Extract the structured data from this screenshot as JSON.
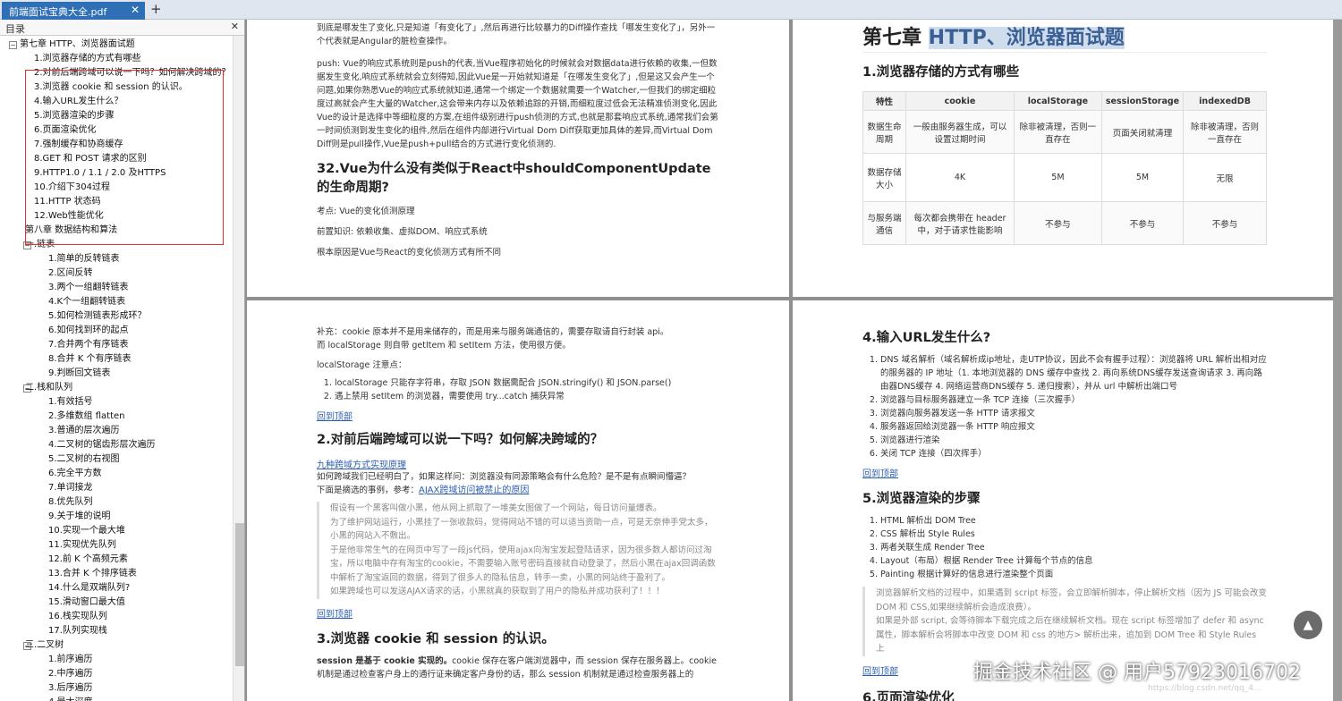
{
  "tab": {
    "title": "前端面试宝典大全.pdf",
    "close": "✕",
    "new": "+"
  },
  "toc": {
    "header": "目录",
    "close": "✕",
    "items": [
      {
        "label": "第七章 HTTP、浏览器面试题",
        "level": 0,
        "toggle": "⊟"
      },
      {
        "label": "1.浏览器存储的方式有哪些",
        "level": 2
      },
      {
        "label": "2.对前后端跨域可以说一下吗？如何解决跨域的？",
        "level": 2
      },
      {
        "label": "3.浏览器 cookie 和 session 的认识。",
        "level": 2
      },
      {
        "label": "4.输入URL发生什么？",
        "level": 2
      },
      {
        "label": "5.浏览器渲染的步骤",
        "level": 2
      },
      {
        "label": "6.页面渲染优化",
        "level": 2
      },
      {
        "label": "7.强制缓存和协商缓存",
        "level": 2
      },
      {
        "label": "8.GET 和 POST 请求的区别",
        "level": 2
      },
      {
        "label": "9.HTTP1.0 / 1.1 / 2.0 及HTTPS",
        "level": 2
      },
      {
        "label": "10.介绍下304过程",
        "level": 2
      },
      {
        "label": "11.HTTP 状态码",
        "level": 2
      },
      {
        "label": "12.Web性能优化",
        "level": 2
      },
      {
        "label": "第八章 数据结构和算法",
        "level": 1
      },
      {
        "label": "一.链表",
        "level": 1,
        "toggle": "⊟"
      },
      {
        "label": "1.简单的反转链表",
        "level": 3
      },
      {
        "label": "2.区间反转",
        "level": 3
      },
      {
        "label": "3.两个一组翻转链表",
        "level": 3
      },
      {
        "label": "4.K个一组翻转链表",
        "level": 3
      },
      {
        "label": "5.如何检测链表形成环？",
        "level": 3
      },
      {
        "label": "6.如何找到环的起点",
        "level": 3
      },
      {
        "label": "7.合并两个有序链表",
        "level": 3
      },
      {
        "label": "8.合并 K 个有序链表",
        "level": 3
      },
      {
        "label": "9.判断回文链表",
        "level": 3
      },
      {
        "label": "二.栈和队列",
        "level": 1,
        "toggle": "⊟"
      },
      {
        "label": "1.有效括号",
        "level": 3
      },
      {
        "label": "2.多维数组 flatten",
        "level": 3
      },
      {
        "label": "3.普通的层次遍历",
        "level": 3
      },
      {
        "label": "4.二叉树的锯齿形层次遍历",
        "level": 3
      },
      {
        "label": "5.二叉树的右视图",
        "level": 3
      },
      {
        "label": "6.完全平方数",
        "level": 3
      },
      {
        "label": "7.单词接龙",
        "level": 3
      },
      {
        "label": "8.优先队列",
        "level": 3
      },
      {
        "label": "9.关于堆的说明",
        "level": 3
      },
      {
        "label": "10.实现一个最大堆",
        "level": 3
      },
      {
        "label": "11.实现优先队列",
        "level": 3
      },
      {
        "label": "12.前 K 个高频元素",
        "level": 3
      },
      {
        "label": "13.合并 K 个排序链表",
        "level": 3
      },
      {
        "label": "14.什么是双端队列?",
        "level": 3
      },
      {
        "label": "15.滑动窗口最大值",
        "level": 3
      },
      {
        "label": "16.栈实现队列",
        "level": 3
      },
      {
        "label": "17.队列实现栈",
        "level": 3
      },
      {
        "label": "三.二叉树",
        "level": 1,
        "toggle": "⊟"
      },
      {
        "label": "1.前序遍历",
        "level": 3
      },
      {
        "label": "2.中序遍历",
        "level": 3
      },
      {
        "label": "3.后序遍历",
        "level": 3
      },
      {
        "label": "4.最大深度",
        "level": 3
      }
    ]
  },
  "tl": {
    "p1": "到底是哪发生了变化,只是知道「有变化了」,然后再进行比较暴力的Diff操作查找「哪发生变化了」，另外一个代表就是Angular的脏检查操作。",
    "p2": "push: Vue的响应式系统则是push的代表,当Vue程序初始化的时候就会对数据data进行依赖的收集,一但数据发生变化,响应式系统就会立刻得知,因此Vue是一开始就知道是「在哪发生变化了」,但是这又会产生一个问题,如果你熟悉Vue的响应式系统就知道,通常一个绑定一个数据就需要一个Watcher,一但我们的绑定细粒度过高就会产生大量的Watcher,这会带来内存以及依赖追踪的开销,而细粒度过低会无法精准侦测变化,因此Vue的设计是选择中等细粒度的方案,在组件级别进行push侦测的方式,也就是那套响应式系统,通常我们会第一时间侦测到发生变化的组件,然后在组件内部进行Virtual Dom Diff获取更加具体的差异,而Virtual Dom Diff则是pull操作,Vue是push+pull结合的方式进行变化侦测的.",
    "h32": "32.Vue为什么没有类似于React中shouldComponentUpdate的生命周期?",
    "p3": "考点: Vue的变化侦测原理",
    "p4": "前置知识: 依赖收集、虚拟DOM、响应式系统",
    "p5": "根本原因是Vue与React的变化侦测方式有所不同"
  },
  "tr": {
    "chapter": "第七章 ",
    "chapter_hl": "HTTP、浏览器面试题",
    "h1": "1.浏览器存储的方式有哪些",
    "headers": [
      "特性",
      "cookie",
      "localStorage",
      "sessionStorage",
      "indexedDB"
    ],
    "rows": [
      [
        "数据生命周期",
        "一般由服务器生成，可以设置过期时间",
        "除非被清理，否则一直存在",
        "页面关闭就清理",
        "除非被清理，否则一直存在"
      ],
      [
        "数据存储大小",
        "4K",
        "5M",
        "5M",
        "无限"
      ],
      [
        "与服务端通信",
        "每次都会携带在 header 中，对于请求性能影响",
        "不参与",
        "不参与",
        "不参与"
      ]
    ]
  },
  "bl": {
    "p1": "补充：cookie 原本并不是用来储存的，而是用来与服务端通信的，需要存取请自行封装 api。",
    "p2": "而 localStorage 则自带 getItem 和 setItem 方法，使用很方便。",
    "p3": "localStorage 注意点：",
    "li": [
      "localStorage 只能存字符串，存取 JSON 数据需配合 JSON.stringify() 和 JSON.parse()",
      "遇上禁用 setItem 的浏览器，需要使用 try...catch 捕获异常"
    ],
    "back": "回到顶部",
    "h2": "2.对前后端跨域可以说一下吗？如何解决跨域的？",
    "link1": "九种跨域方式实现原理",
    "p4": "如何跨域我们已经明白了，如果这样问：浏览器没有同源策略会有什么危险？是不是有点瞬间懵逼？",
    "p5a": "下面是摘选的事例，参考：",
    "p5link": "AJAX跨域访问被禁止的原因",
    "q1": "假设有一个黑客叫做小黑，他从网上抓取了一堆美女图做了一个网站，每日访问量爆表。",
    "q2": "为了维护网站运行，小黑挂了一张收款码，觉得网站不错的可以适当资助一点，可是无奈伸手党太多，小黑的网站入不敷出。",
    "q3": "于是他非常生气的在网页中写了一段js代码，使用ajax向淘宝发起登陆请求，因为很多数人都访问过淘宝，所以电脑中存有淘宝的cookie，不需要输入账号密码直接就自动登录了，然后小黑在ajax回调函数中解析了淘宝返回的数据，得到了很多人的隐私信息，转手一卖，小黑的网站终于盈利了。",
    "q4": "如果跨域也可以发送AJAX请求的话，小黑就真的获取到了用户的隐私并成功获利了！！！",
    "back2": "回到顶部",
    "h3": "3.浏览器 cookie 和 session 的认识。",
    "p6b": "session 是基于 cookie 实现的。",
    "p6": "cookie 保存在客户端浏览器中，而 session 保存在服务器上。cookie 机制是通过检查客户身上的通行证来确定客户身份的话，那么 session 机制就是通过检查服务器上的"
  },
  "br": {
    "h4": "4.输入URL发生什么?",
    "li": [
      "DNS 域名解析（域名解析成ip地址，走UTP协议，因此不会有握手过程）：浏览器将 URL 解析出相对应的服务器的 IP 地址（1. 本地浏览器的 DNS 缓存中查找 2. 再向系统DNS缓存发送查询请求 3. 再向路由器DNS缓存 4. 网络运营商DNS缓存 5. 递归搜索），并从 url 中解析出端口号",
      "浏览器与目标服务器建立一条 TCP 连接（三次握手）",
      "浏览器向服务器发送一条 HTTP 请求报文",
      "服务器返回给浏览器一条 HTTP 响应报文",
      "浏览器进行渲染",
      "关闭 TCP 连接（四次挥手）"
    ],
    "back": "回到顶部",
    "h5": "5.浏览器渲染的步骤",
    "li2": [
      "HTML 解析出 DOM Tree",
      "CSS 解析出 Style Rules",
      "两者关联生成 Render Tree",
      "Layout（布局）根据 Render Tree 计算每个节点的信息",
      "Painting 根据计算好的信息进行渲染整个页面"
    ],
    "q1": "浏览器解析文档的过程中，如果遇到 script 标签，会立即解析脚本，停止解析文档（因为 JS 可能会改变 DOM 和 CSS,如果继续解析会造成浪费）。",
    "q2": "如果是外部 script, 会等待脚本下载完成之后在继续解析文档。现在 script 标签增加了 defer 和 async 属性，脚本解析会将脚本中改变 DOM 和 css 的地方> 解析出来，追加到 DOM Tree 和 Style Rules 上",
    "back2": "回到顶部",
    "h6": "6.页面渲染优化"
  },
  "watermark": "掘金技术社区 @ 用户57923016702",
  "csdn": "https://blog.csdn.net/qq_4..."
}
